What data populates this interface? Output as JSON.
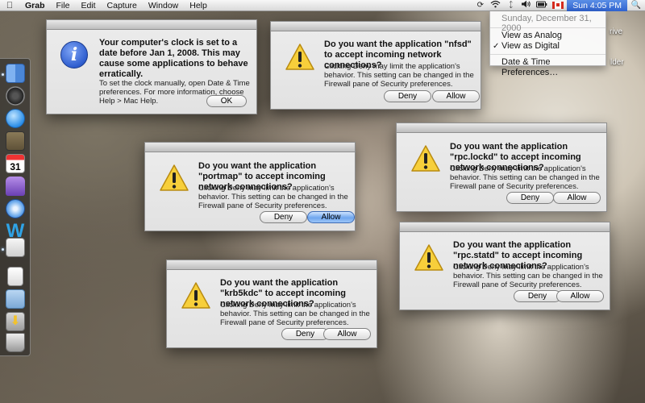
{
  "menubar": {
    "app_name": "Grab",
    "items": [
      "File",
      "Edit",
      "Capture",
      "Window",
      "Help"
    ],
    "clock": "Sun 4:05 PM",
    "status_icons": [
      "time-machine-icon",
      "wifi-icon",
      "bluetooth-icon",
      "volume-icon",
      "battery-icon",
      "input-flag-icon",
      "spotlight-icon"
    ]
  },
  "clock_menu": {
    "date": "Sunday, December 31, 2000",
    "items": [
      {
        "label": "View as Analog",
        "checked": false
      },
      {
        "label": "View as Digital",
        "checked": true
      },
      {
        "label": "Date & Time Preferences…",
        "checked": false
      }
    ]
  },
  "desktop_edge": {
    "line1": "rive",
    "line2": "lder"
  },
  "dock": {
    "apps": [
      "finder-icon",
      "dashboard-icon",
      "itunes-icon",
      "iphoto-icon",
      "ical-icon",
      "app-icon",
      "safari-icon",
      "word-icon",
      "preview-icon",
      "document-icon",
      "folder-icon",
      "downloads-icon",
      "trash-icon"
    ]
  },
  "dialogs": {
    "clock_warning": {
      "title": "Your computer's clock is set to a date before Jan 1, 2008. This may cause some applications to behave erratically.",
      "body": "To set the clock manually, open Date & Time preferences. For more information, choose Help > Mac Help.",
      "ok_label": "OK"
    },
    "nfsd": {
      "title": "Do you want the application \"nfsd\" to accept incoming network connections?",
      "body": "Clicking Deny may limit the application's behavior. This setting can be changed in the Firewall pane of Security preferences.",
      "deny_label": "Deny",
      "allow_label": "Allow"
    },
    "portmap": {
      "title": "Do you want the application \"portmap\" to accept incoming network connections?",
      "body": "Clicking Deny may limit the application's behavior. This setting can be changed in the Firewall pane of Security preferences.",
      "deny_label": "Deny",
      "allow_label": "Allow"
    },
    "rpc_lockd": {
      "title": "Do you want the application \"rpc.lockd\" to accept incoming network connections?",
      "body": "Clicking Deny may limit the application's behavior. This setting can be changed in the Firewall pane of Security preferences.",
      "deny_label": "Deny",
      "allow_label": "Allow"
    },
    "rpc_statd": {
      "title": "Do you want the application \"rpc.statd\" to accept incoming network connections?",
      "body": "Clicking Deny may limit the application's behavior. This setting can be changed in the Firewall pane of Security preferences.",
      "deny_label": "Deny",
      "allow_label": "Allow"
    },
    "krb5kdc": {
      "title": "Do you want the application \"krb5kdc\" to accept incoming network connections?",
      "body": "Clicking Deny may limit the application's behavior. This setting can be changed in the Firewall pane of Security preferences.",
      "deny_label": "Deny",
      "allow_label": "Allow"
    }
  }
}
